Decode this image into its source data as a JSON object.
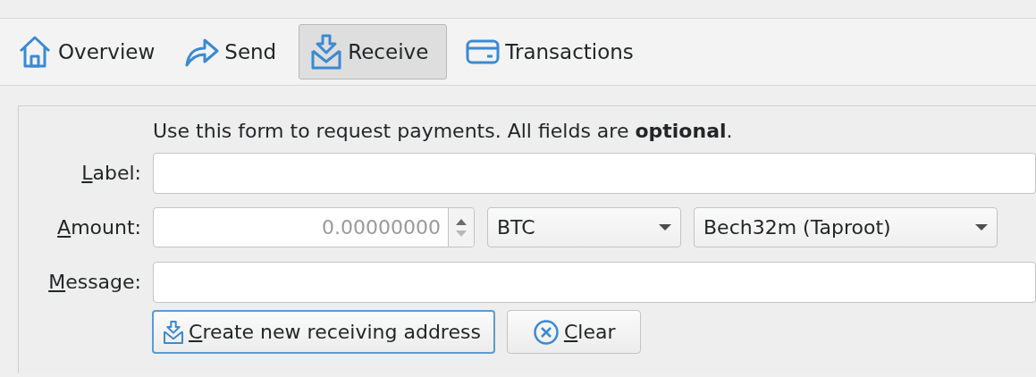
{
  "toolbar": [
    {
      "label": "Overview",
      "selected": false
    },
    {
      "label": "Send",
      "selected": false
    },
    {
      "label": "Receive",
      "selected": true
    },
    {
      "label": "Transactions",
      "selected": false
    }
  ],
  "form": {
    "intro": "Use this form to request payments. All fields are **optional**.",
    "label_field": {
      "label": "Label:"
    },
    "amount_field": {
      "label": "Amount:",
      "placeholder": "0.00000000",
      "unit": "BTC",
      "address_type": "Bech32m (Taproot)"
    },
    "message_field": {
      "label": "Message:"
    },
    "buttons": [
      {
        "label": "Create new receiving address",
        "kind": "create",
        "default": true
      },
      {
        "label": "Clear",
        "kind": "clear",
        "default": false
      }
    ]
  }
}
